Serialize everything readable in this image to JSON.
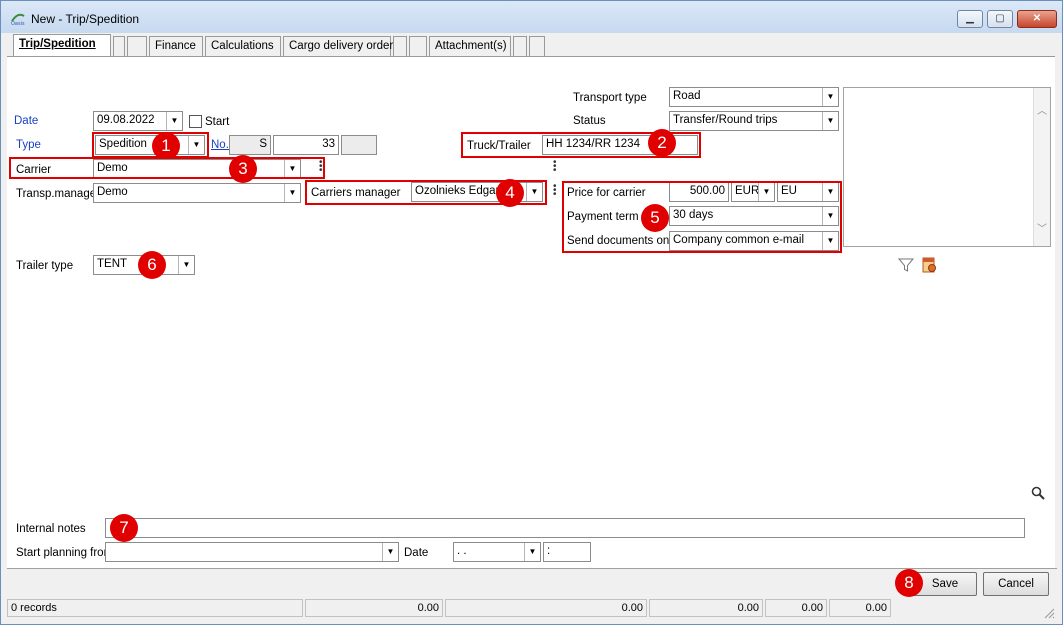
{
  "window": {
    "title": "New - Trip/Spedition",
    "app_icon": "app-logo-icon"
  },
  "tabs": [
    {
      "label": "Trip/Spedition"
    },
    {
      "label": ""
    },
    {
      "label": ""
    },
    {
      "label": "Finance"
    },
    {
      "label": "Calculations"
    },
    {
      "label": "Cargo delivery order"
    },
    {
      "label": ""
    },
    {
      "label": ""
    },
    {
      "label": "Attachment(s)"
    },
    {
      "label": ""
    },
    {
      "label": ""
    }
  ],
  "form": {
    "date_label": "Date",
    "date_value": "09.08.2022",
    "start_label": "Start",
    "type_label": "Type",
    "type_value": "Spedition",
    "no_label": "No.",
    "no_series": "S",
    "no_value": "33",
    "carrier_label": "Carrier",
    "carrier_value": "Demo",
    "transp_manager_label": "Transp.manager",
    "transp_manager_value": "Demo",
    "carriers_manager_label": "Carriers manager",
    "carriers_manager_value": "Ozolnieks Edgars",
    "trailer_type_label": "Trailer type",
    "trailer_type_value": "TENT",
    "transport_type_label": "Transport type",
    "transport_type_value": "Road",
    "status_label": "Status",
    "status_value": "Transfer/Round trips",
    "truck_trailer_label": "Truck/Trailer",
    "truck_trailer_value": "HH 1234/RR 1234",
    "price_label": "Price for carrier",
    "price_value": "500.00",
    "price_currency": "EUR",
    "price_region": "EU",
    "payment_term_label": "Payment term",
    "payment_term_value": "30 days",
    "send_docs_label": "Send documents on",
    "send_docs_value": "Company common e-mail",
    "internal_notes_label": "Internal notes",
    "internal_notes_value": "",
    "start_planning_label": "Start planning from",
    "start_planning_value": "",
    "date2_label": "Date",
    "date2_value": " .  .",
    "time2_value": " :"
  },
  "badges": [
    "1",
    "2",
    "3",
    "4",
    "5",
    "6",
    "7",
    "8"
  ],
  "buttons": {
    "save": "Save",
    "cancel": "Cancel"
  },
  "status_bar": {
    "records": "0 records",
    "v1": "0.00",
    "v2": "0.00",
    "v3": "0.00",
    "v4": "0.00",
    "v5": "0.00"
  },
  "colors": {
    "highlight": "#e00000",
    "blue_label": "#1a3fc4"
  }
}
